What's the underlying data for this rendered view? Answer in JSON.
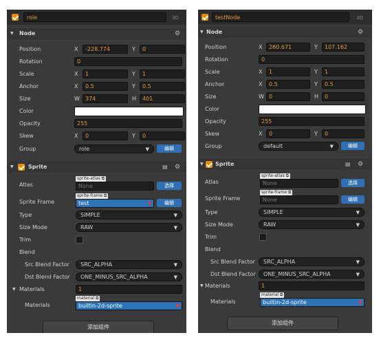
{
  "left": {
    "node_name": "role",
    "tag_3d": "3D",
    "node_section": "Node",
    "position": {
      "label": "Position",
      "x": "-228.774",
      "y": "0"
    },
    "rotation": {
      "label": "Rotation",
      "value": "0"
    },
    "scale": {
      "label": "Scale",
      "x": "1",
      "y": "1"
    },
    "anchor": {
      "label": "Anchor",
      "x": "0.5",
      "y": "0.5"
    },
    "size": {
      "label": "Size",
      "w": "374",
      "h": "401"
    },
    "color": {
      "label": "Color",
      "value": "#ffffff"
    },
    "opacity": {
      "label": "Opacity",
      "value": "255"
    },
    "skew": {
      "label": "Skew",
      "x": "0",
      "y": "0"
    },
    "group": {
      "label": "Group",
      "value": "role",
      "edit": "编辑"
    },
    "sprite_section": "Sprite",
    "atlas": {
      "label": "Atlas",
      "tag": "sprite-atlas",
      "value": "None",
      "button": "选择"
    },
    "sprite_frame": {
      "label": "Sprite Frame",
      "tag": "sprite-frame",
      "value": "test",
      "button": "编辑"
    },
    "type": {
      "label": "Type",
      "value": "SIMPLE"
    },
    "size_mode": {
      "label": "Size Mode",
      "value": "RAW"
    },
    "trim": {
      "label": "Trim"
    },
    "blend": {
      "label": "Blend"
    },
    "src_blend": {
      "label": "Src Blend Factor",
      "value": "SRC_ALPHA"
    },
    "dst_blend": {
      "label": "Dst Blend Factor",
      "value": "ONE_MINUS_SRC_ALPHA"
    },
    "materials": {
      "label": "Materials",
      "count": "1"
    },
    "material_item": {
      "label": "Materials",
      "tag": "material",
      "value": "builtin-2d-sprite"
    },
    "add_component": "添加组件"
  },
  "right": {
    "node_name": "testNode",
    "tag_3d": "3D",
    "node_section": "Node",
    "position": {
      "label": "Position",
      "x": "260.671",
      "y": "107.162"
    },
    "rotation": {
      "label": "Rotation",
      "value": "0"
    },
    "scale": {
      "label": "Scale",
      "x": "1",
      "y": "1"
    },
    "anchor": {
      "label": "Anchor",
      "x": "0.5",
      "y": "0.5"
    },
    "size": {
      "label": "Size",
      "w": "0",
      "h": "0"
    },
    "color": {
      "label": "Color",
      "value": "#ffffff"
    },
    "opacity": {
      "label": "Opacity",
      "value": "255"
    },
    "skew": {
      "label": "Skew",
      "x": "0",
      "y": "0"
    },
    "group": {
      "label": "Group",
      "value": "default",
      "edit": "编辑"
    },
    "sprite_section": "Sprite",
    "atlas": {
      "label": "Atlas",
      "tag": "sprite-atlas",
      "value": "None",
      "button": "选择"
    },
    "sprite_frame": {
      "label": "Sprite Frame",
      "tag": "sprite-frame",
      "value": "None",
      "button": "编辑"
    },
    "type": {
      "label": "Type",
      "value": "SIMPLE"
    },
    "size_mode": {
      "label": "Size Mode",
      "value": "RAW"
    },
    "trim": {
      "label": "Trim"
    },
    "blend": {
      "label": "Blend"
    },
    "src_blend": {
      "label": "Src Blend Factor",
      "value": "SRC_ALPHA"
    },
    "dst_blend": {
      "label": "Dst Blend Factor",
      "value": "ONE_MINUS_SRC_ALPHA"
    },
    "materials": {
      "label": "Materials",
      "count": "1"
    },
    "material_item": {
      "label": "Materials",
      "tag": "material",
      "value": "builtin-2d-sprite"
    },
    "add_component": "添加组件"
  },
  "axis": {
    "x": "X",
    "y": "Y",
    "w": "W",
    "h": "H"
  },
  "icons": {
    "gear": "gear-icon",
    "book": "book-icon",
    "close": "close-icon",
    "link": "link-icon",
    "dropdown": "chevron-down-icon",
    "collapse": "triangle-down-icon"
  }
}
